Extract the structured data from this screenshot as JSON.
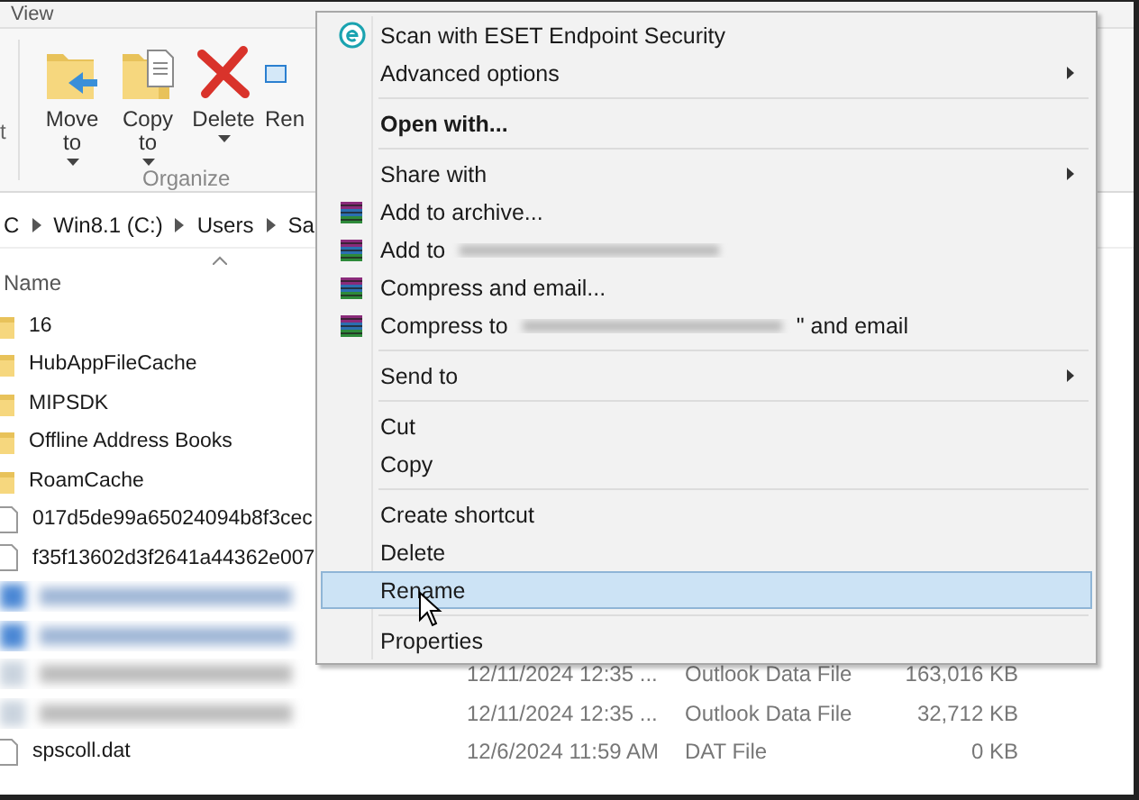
{
  "explorer": {
    "tab": "View",
    "ribbon": {
      "cut_label": "t",
      "buttons": [
        {
          "label": "Move to",
          "kind": "move",
          "caret": true
        },
        {
          "label": "Copy to",
          "kind": "copy",
          "caret": true
        },
        {
          "label": "Delete",
          "kind": "delete",
          "caret": true
        },
        {
          "label": "Ren",
          "kind": "rename"
        }
      ],
      "group": "Organize"
    },
    "breadcrumb": [
      "C",
      "Win8.1 (C:)",
      "Users",
      "Sa"
    ],
    "column": "Name",
    "files": [
      {
        "kind": "folder",
        "name": "16"
      },
      {
        "kind": "folder",
        "name": "HubAppFileCache"
      },
      {
        "kind": "folder",
        "name": "MIPSDK"
      },
      {
        "kind": "folder",
        "name": "Offline Address Books"
      },
      {
        "kind": "folder",
        "name": "RoamCache"
      },
      {
        "kind": "file",
        "name": "017d5de99a65024094b8f3cec"
      },
      {
        "kind": "file",
        "name": "f35f13602d3f2641a44362e007"
      },
      {
        "kind": "redacted",
        "selected": true
      },
      {
        "kind": "redacted",
        "selected": true
      },
      {
        "kind": "redacted",
        "selected": false,
        "date": "12/11/2024 12:35 ...",
        "type": "Outlook Data File",
        "size": "163,016 KB"
      },
      {
        "kind": "redacted",
        "selected": false,
        "date": "12/11/2024 12:35 ...",
        "type": "Outlook Data File",
        "size": "32,712 KB"
      },
      {
        "kind": "file",
        "name": "spscoll.dat",
        "date": "12/6/2024 11:59 AM",
        "type": "DAT File",
        "size": "0 KB"
      }
    ]
  },
  "menu": {
    "groups": [
      [
        {
          "label": "Scan with ESET Endpoint Security",
          "kind": "eset",
          "selected": false
        },
        {
          "label": "Advanced options",
          "submenu": true,
          "selected": false
        }
      ],
      [
        {
          "label": "Open with...",
          "bold": true,
          "selected": false
        }
      ],
      [
        {
          "label": "Share with",
          "submenu": true,
          "selected": false
        },
        {
          "label": "Add to archive...",
          "kind": "archive",
          "selected": false
        },
        {
          "label": "Add to",
          "kind": "archive",
          "redacted": true,
          "selected": false
        },
        {
          "label": "Compress and email...",
          "kind": "archive",
          "selected": false
        },
        {
          "label": "Compress to",
          "kind": "archive",
          "redacted": true,
          "suffix": "\" and email",
          "selected": false
        }
      ],
      [
        {
          "label": "Send to",
          "submenu": true,
          "selected": false
        }
      ],
      [
        {
          "label": "Cut",
          "selected": false
        },
        {
          "label": "Copy",
          "selected": false
        }
      ],
      [
        {
          "label": "Create shortcut",
          "selected": false
        },
        {
          "label": "Delete",
          "selected": false
        },
        {
          "label": "Rename",
          "selected": true
        }
      ],
      [
        {
          "label": "Properties",
          "selected": false
        }
      ]
    ]
  }
}
